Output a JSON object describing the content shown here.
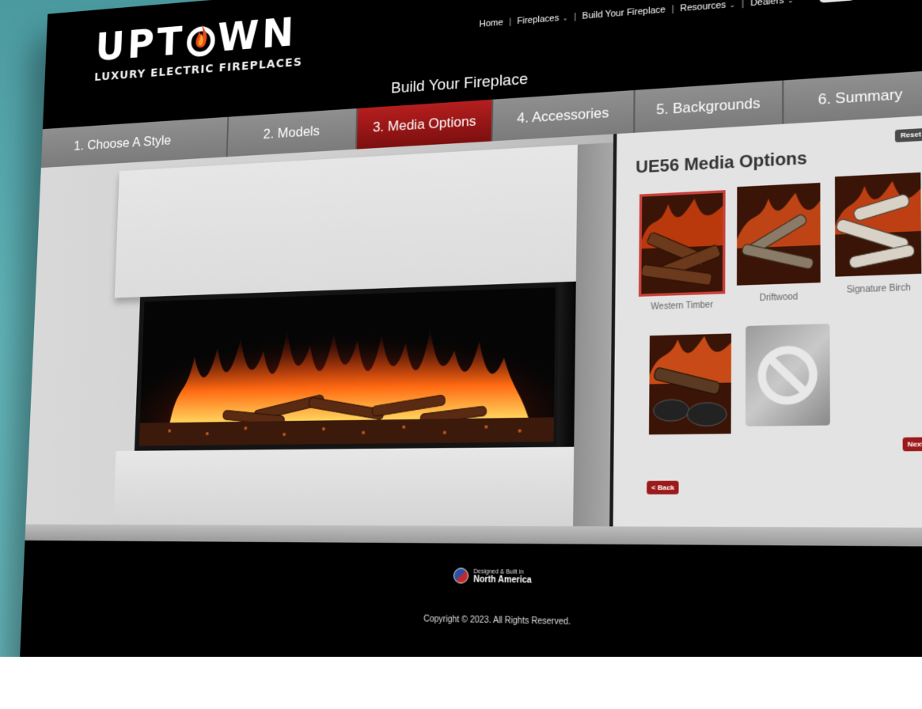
{
  "brand": {
    "name_pre": "UPT",
    "name_post": "WN",
    "tagline": "LUXURY ELECTRIC FIREPLACES"
  },
  "nav": {
    "items": [
      {
        "label": "Home",
        "has_menu": false
      },
      {
        "label": "Fireplaces",
        "has_menu": true
      },
      {
        "label": "Build Your Fireplace",
        "has_menu": false
      },
      {
        "label": "Resources",
        "has_menu": true
      },
      {
        "label": "Dealers",
        "has_menu": true
      }
    ],
    "search_icon": "search-icon"
  },
  "page": {
    "title": "Build Your Fireplace"
  },
  "steps": [
    {
      "label": "1. Choose A Style",
      "active": false
    },
    {
      "label": "2. Models",
      "active": false
    },
    {
      "label": "3. Media Options",
      "active": true
    },
    {
      "label": "4. Accessories",
      "active": false
    },
    {
      "label": "5. Backgrounds",
      "active": false
    },
    {
      "label": "6. Summary",
      "active": false
    }
  ],
  "options_panel": {
    "title": "UE56 Media Options",
    "reset_label": "Reset",
    "next_label": "Next >",
    "back_label": "< Back",
    "media": [
      {
        "label": "Western Timber",
        "selected": true
      },
      {
        "label": "Driftwood",
        "selected": false
      },
      {
        "label": "Signature Birch",
        "selected": false
      },
      {
        "label": "",
        "selected": false
      },
      {
        "label": "",
        "selected": false,
        "none_option": true
      }
    ]
  },
  "footer": {
    "badge_line1": "Designed & Built in",
    "badge_line2": "North America",
    "copyright": "Copyright © 2023. All Rights Reserved."
  },
  "colors": {
    "accent": "#9c1a1a",
    "active_tab": "#b51e1e",
    "tab_gray": "#7b7b7b",
    "background": "#5fb2b6"
  }
}
